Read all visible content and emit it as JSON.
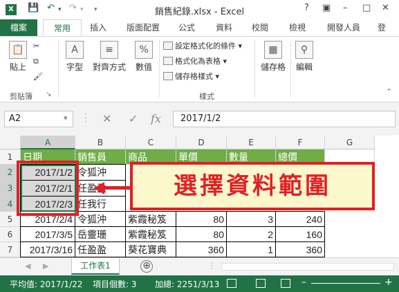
{
  "app": {
    "title": "銷售紀錄.xlsx - Excel",
    "logo": "X"
  },
  "window_controls": {
    "help": "?",
    "minimize": "–",
    "maximize": "□",
    "close": "✕"
  },
  "tabs": [
    "檔案",
    "常用",
    "插入",
    "版面配置",
    "公式",
    "資料",
    "校閱",
    "檢視",
    "開發人員",
    "登"
  ],
  "ribbon": {
    "paste": "貼上",
    "clipboard": "剪貼簿",
    "font": "字型",
    "align": "對齊方式",
    "number": "數值",
    "conditional": "設定格式化的條件",
    "format_table": "格式化為表格",
    "cell_styles": "儲存格樣式",
    "styles": "樣式",
    "cells": "儲存格",
    "editing": "編輯",
    "percent_glyph": "%"
  },
  "formula_bar": {
    "name_box": "A2",
    "value": "2017/1/2",
    "fx": "fx"
  },
  "grid": {
    "columns": [
      "A",
      "B",
      "C",
      "D",
      "E",
      "F",
      "G"
    ],
    "rows": [
      "1",
      "2",
      "3",
      "4",
      "5",
      "6",
      "7"
    ],
    "header_row": [
      "日期",
      "銷售員",
      "商品",
      "單價",
      "數量",
      "總價",
      ""
    ],
    "data": [
      [
        "2017/1/2",
        "令狐沖",
        "",
        "",
        "",
        "",
        ""
      ],
      [
        "2017/2/1",
        "任盈盈",
        "",
        "",
        "",
        "",
        ""
      ],
      [
        "2017/2/3",
        "任我行",
        "",
        "",
        "",
        "",
        ""
      ],
      [
        "2017/2/4",
        "令狐沖",
        "紫霞秘笈",
        "80",
        "3",
        "240",
        ""
      ],
      [
        "2017/3/5",
        "岳靈珊",
        "紫霞秘笈",
        "80",
        "2",
        "160",
        ""
      ],
      [
        "2017/3/16",
        "任盈盈",
        "葵花寶典",
        "360",
        "1",
        "360",
        ""
      ]
    ]
  },
  "callout": {
    "text": "選擇資料範圍",
    "color": "#e21f26"
  },
  "sheet": {
    "tab": "工作表1",
    "add": "⊕"
  },
  "status": {
    "average": "平均值: 2017/1/22",
    "count": "項目個數: 3",
    "sum": "加總: 2251/3/13",
    "zoom_minus": "–",
    "zoom_plus": "+"
  },
  "colors": {
    "accent": "#217346",
    "header_fill": "#70ad47"
  }
}
